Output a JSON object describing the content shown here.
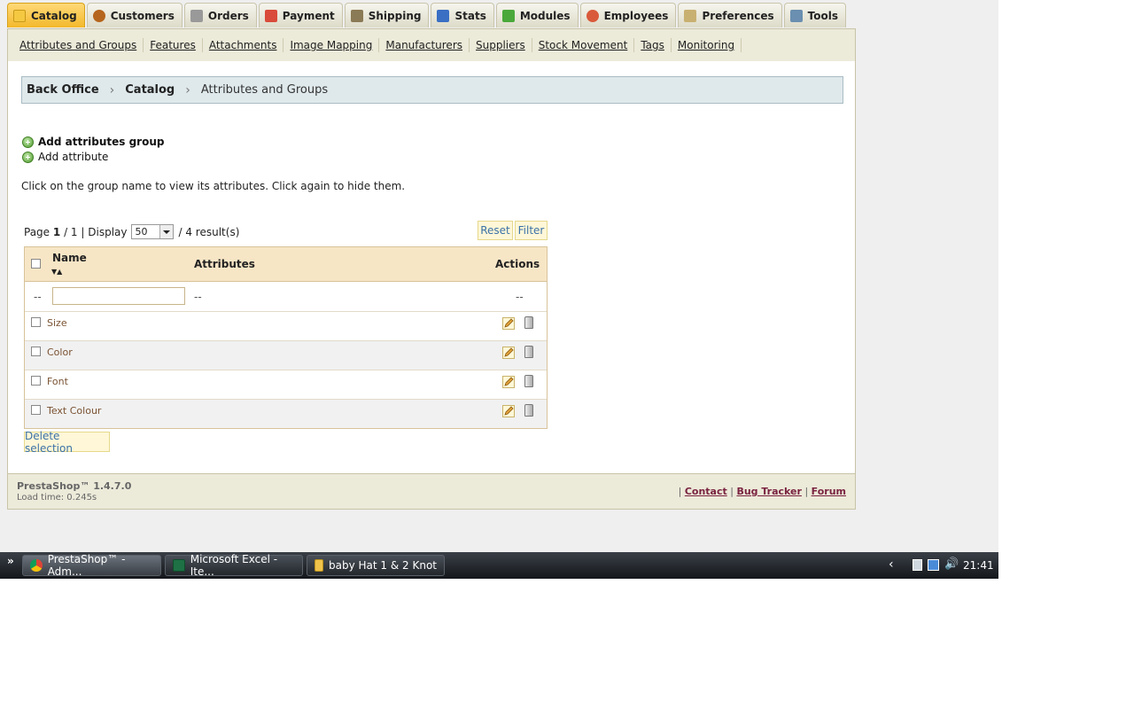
{
  "tabs": [
    {
      "label": "Catalog",
      "icon": "folder-icon",
      "active": true,
      "color": "#f5c842"
    },
    {
      "label": "Customers",
      "icon": "user-icon",
      "color": "#b5651d"
    },
    {
      "label": "Orders",
      "icon": "cart-icon",
      "color": "#777777"
    },
    {
      "label": "Payment",
      "icon": "payment-icon",
      "color": "#d94b3a"
    },
    {
      "label": "Shipping",
      "icon": "truck-icon",
      "color": "#8a7a55"
    },
    {
      "label": "Stats",
      "icon": "chart-icon",
      "color": "#3a6fc4"
    },
    {
      "label": "Modules",
      "icon": "puzzle-icon",
      "color": "#4aa83a"
    },
    {
      "label": "Employees",
      "icon": "employee-icon",
      "color": "#d95a3a"
    },
    {
      "label": "Preferences",
      "icon": "preferences-icon",
      "color": "#c8b070"
    },
    {
      "label": "Tools",
      "icon": "wrench-icon",
      "color": "#6a8fb0"
    }
  ],
  "subnav": [
    "Attributes and Groups",
    "Features",
    "Attachments",
    "Image Mapping",
    "Manufacturers",
    "Suppliers",
    "Stock Movement",
    "Tags",
    "Monitoring"
  ],
  "breadcrumb": {
    "root": "Back Office",
    "section": "Catalog",
    "current": "Attributes and Groups"
  },
  "actions": {
    "add_group": "Add attributes group",
    "add_attribute": "Add attribute"
  },
  "hint": "Click on the group name to view its attributes. Click again to hide them.",
  "pager": {
    "page_prefix": "Page",
    "page": "1",
    "pages": "/ 1",
    "display": "| Display",
    "per_page": "50",
    "results": "/ 4 result(s)"
  },
  "buttons": {
    "reset": "Reset",
    "filter": "Filter",
    "delete_selection": "Delete selection"
  },
  "table": {
    "headers": {
      "name": "Name",
      "attributes": "Attributes",
      "actions": "Actions"
    },
    "filter_placeholder_left": "--",
    "filter_attr": "--",
    "filter_actions": "--",
    "rows": [
      {
        "name": "Size"
      },
      {
        "name": "Color"
      },
      {
        "name": "Font"
      },
      {
        "name": "Text Colour"
      }
    ]
  },
  "footer": {
    "version": "PrestaShop™ 1.4.7.0",
    "load_time": "Load time: 0.245s",
    "contact": "Contact",
    "bug_tracker": "Bug Tracker",
    "forum": "Forum"
  },
  "taskbar": {
    "windows": [
      {
        "label": "PrestaShop™ - Adm...",
        "icon": "chrome-icon",
        "active": true
      },
      {
        "label": "Microsoft Excel - Ite...",
        "icon": "excel-icon"
      },
      {
        "label": "baby Hat 1 & 2 Knot",
        "icon": "folder-icon"
      }
    ],
    "clock": "21:41"
  }
}
